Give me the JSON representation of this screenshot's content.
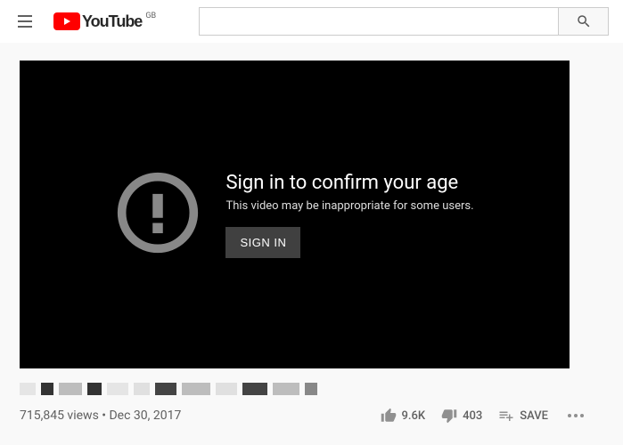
{
  "header": {
    "brand": "YouTube",
    "country_code": "GB",
    "search_placeholder": ""
  },
  "player_gate": {
    "title": "Sign in to confirm your age",
    "subtitle": "This video may be inappropriate for some users.",
    "button": "SIGN IN"
  },
  "meta": {
    "views": "715,845 views",
    "separator": " • ",
    "date": "Dec 30, 2017"
  },
  "actions": {
    "likes": "9.6K",
    "dislikes": "403",
    "save": "SAVE"
  }
}
